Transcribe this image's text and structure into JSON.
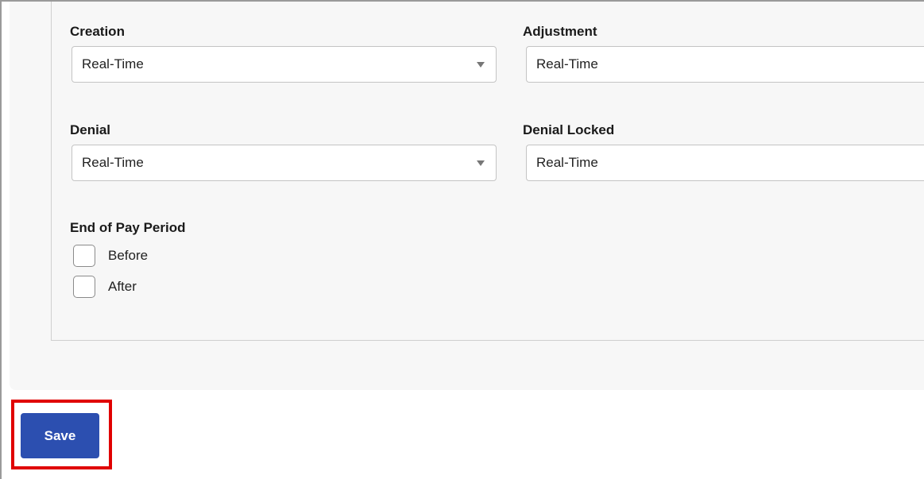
{
  "form": {
    "creation": {
      "label": "Creation",
      "value": "Real-Time"
    },
    "adjustment": {
      "label": "Adjustment",
      "value": "Real-Time"
    },
    "denial": {
      "label": "Denial",
      "value": "Real-Time"
    },
    "denial_locked": {
      "label": "Denial Locked",
      "value": "Real-Time"
    },
    "end_of_pay_period": {
      "label": "End of Pay Period",
      "options": [
        {
          "label": "Before",
          "checked": false
        },
        {
          "label": "After",
          "checked": false
        }
      ]
    }
  },
  "actions": {
    "save_label": "Save"
  },
  "colors": {
    "save_button": "#2c4fb0",
    "highlight": "#e00000",
    "panel_background": "#f7f7f7"
  },
  "icons": {
    "select_caret": "chevron-down-icon"
  }
}
